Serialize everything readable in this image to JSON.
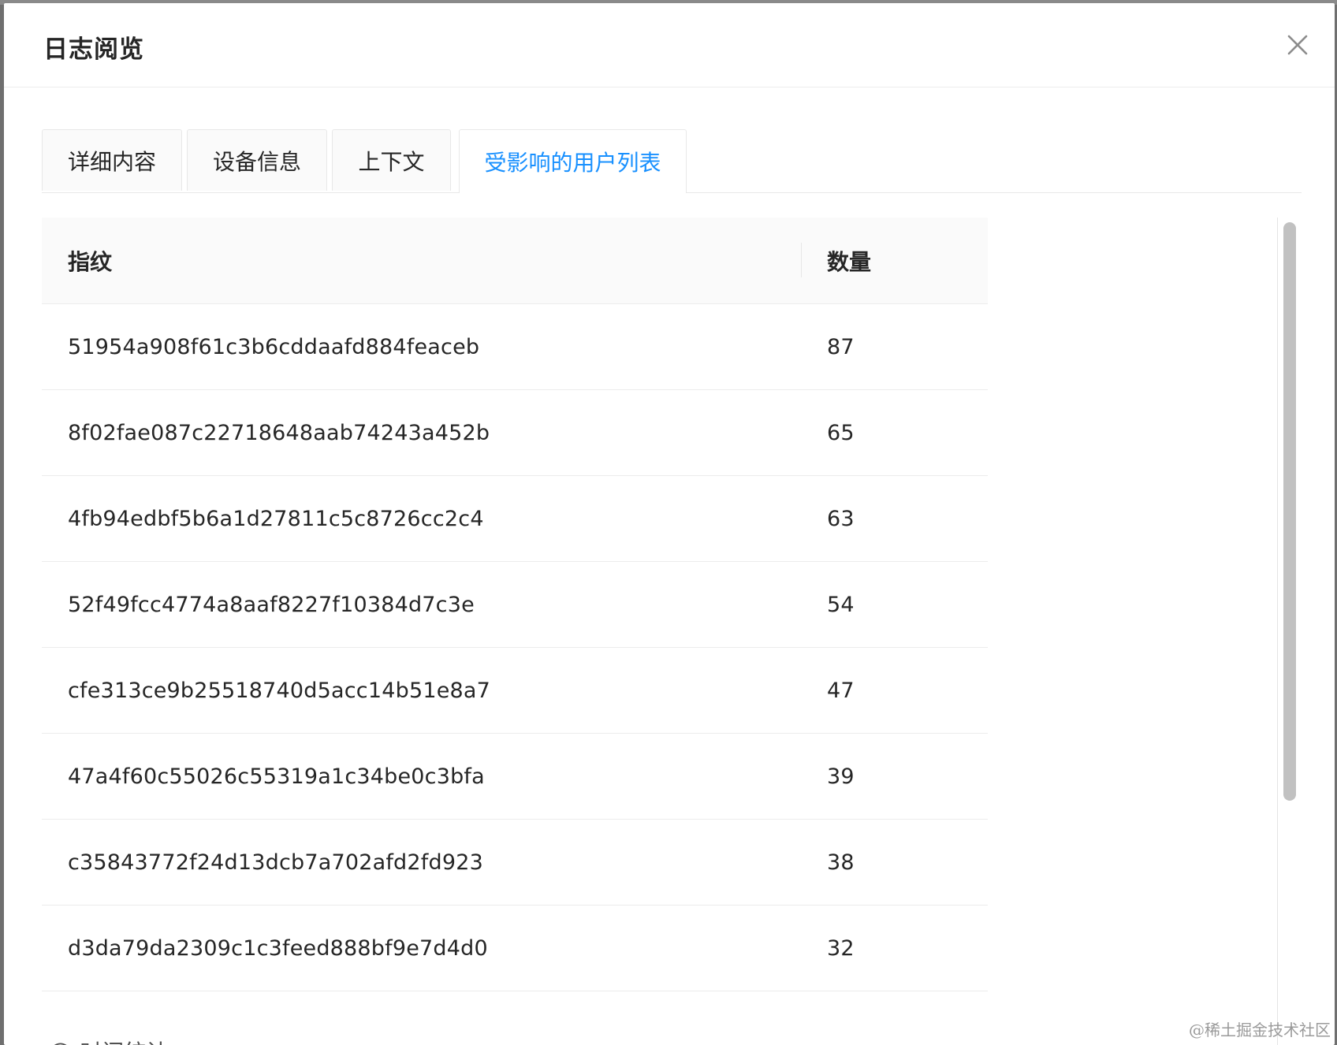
{
  "modal": {
    "title": "日志阅览",
    "close_icon": "close-icon"
  },
  "tabs": [
    {
      "label": "详细内容",
      "active": false
    },
    {
      "label": "设备信息",
      "active": false
    },
    {
      "label": "上下文",
      "active": false
    },
    {
      "label": "受影响的用户列表",
      "active": true
    }
  ],
  "table": {
    "columns": [
      "指纹",
      "数量"
    ],
    "rows": [
      {
        "fingerprint": "51954a908f61c3b6cddaafd884feaceb",
        "count": "87"
      },
      {
        "fingerprint": "8f02fae087c22718648aab74243a452b",
        "count": "65"
      },
      {
        "fingerprint": "4fb94edbf5b6a1d27811c5c8726cc2c4",
        "count": "63"
      },
      {
        "fingerprint": "52f49fcc4774a8aaf8227f10384d7c3e",
        "count": "54"
      },
      {
        "fingerprint": "cfe313ce9b25518740d5acc14b51e8a7",
        "count": "47"
      },
      {
        "fingerprint": "47a4f60c55026c55319a1c34be0c3bfa",
        "count": "39"
      },
      {
        "fingerprint": "c35843772f24d13dcb7a702afd2fd923",
        "count": "38"
      },
      {
        "fingerprint": "d3da79da2309c1c3feed888bf9e7d4d0",
        "count": "32"
      }
    ]
  },
  "footer": {
    "partial_text": "◯ 时间统计"
  },
  "watermark": "@稀土掘金技术社区",
  "colors": {
    "accent": "#1890ff",
    "header_bg": "#fafafa",
    "border": "#ececec"
  }
}
